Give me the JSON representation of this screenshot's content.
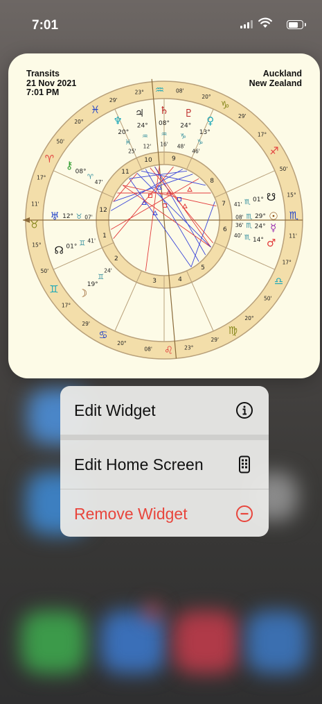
{
  "status_bar": {
    "time": "7:01"
  },
  "widget": {
    "header_left": [
      "Transits",
      "21 Nov 2021",
      "7:01 PM"
    ],
    "header_right": [
      "Auckland",
      "New Zealand"
    ],
    "colors": {
      "wheel_band": "#f3deaa",
      "wheel_line": "#b8a07a",
      "bg": "#fdfbe7",
      "aspect_red": "#e23b3b",
      "aspect_blue": "#3a45d8"
    },
    "house_numbers": [
      "1",
      "2",
      "3",
      "4",
      "5",
      "6",
      "7",
      "8",
      "9",
      "10",
      "11",
      "12"
    ],
    "sign_cusps": [
      {
        "glyph": "♒",
        "deg": "23°",
        "min": "08'",
        "color": "#1aa7b8"
      },
      {
        "glyph": "♑",
        "deg": "20°",
        "min": "29'",
        "color": "#8a8a20"
      },
      {
        "glyph": "♐",
        "deg": "17°",
        "min": "50'",
        "color": "#e23b3b"
      },
      {
        "glyph": "♏",
        "deg": "15°",
        "min": "11'",
        "color": "#2344c8"
      },
      {
        "glyph": "♎",
        "deg": "17°",
        "min": "50'",
        "color": "#1aa7b8"
      },
      {
        "glyph": "♍",
        "deg": "20°",
        "min": "29'",
        "color": "#8a8a20"
      },
      {
        "glyph": "♌",
        "deg": "23°",
        "min": "08'",
        "color": "#e23b3b"
      },
      {
        "glyph": "♋",
        "deg": "20°",
        "min": "29'",
        "color": "#2344c8"
      },
      {
        "glyph": "♊",
        "deg": "17°",
        "min": "50'",
        "color": "#1aa7b8"
      },
      {
        "glyph": "♉",
        "deg": "15°",
        "min": "11'",
        "color": "#8a8a20"
      },
      {
        "glyph": "♈",
        "deg": "17°",
        "min": "50'",
        "color": "#e23b3b"
      },
      {
        "glyph": "♓",
        "deg": "20°",
        "min": "29'",
        "color": "#2344c8"
      }
    ],
    "planets": [
      {
        "glyph": "♃",
        "deg": "24°",
        "sign": "♒",
        "min": "12'",
        "color": "#333"
      },
      {
        "glyph": "♄",
        "deg": "08°",
        "sign": "♒",
        "min": "16'",
        "color": "#b22"
      },
      {
        "glyph": "♇",
        "deg": "24°",
        "sign": "♑",
        "min": "48'",
        "color": "#b22"
      },
      {
        "glyph": "♀",
        "deg": "13°",
        "sign": "♑",
        "min": "46'",
        "color": "#1aa7b8"
      },
      {
        "glyph": "♆",
        "deg": "20°",
        "sign": "♓",
        "min": "25'",
        "color": "#1aa7b8"
      },
      {
        "glyph": "⚷",
        "deg": "08°",
        "sign": "♈",
        "min": "47'",
        "color": "#2a9a2a"
      },
      {
        "glyph": "♅",
        "deg": "12°",
        "sign": "♉",
        "min": "07'",
        "color": "#2344c8"
      },
      {
        "glyph": "☊",
        "deg": "01°",
        "sign": "♊",
        "min": "41'",
        "color": "#111"
      },
      {
        "glyph": "☽",
        "deg": "19°",
        "sign": "♊",
        "min": "24'",
        "color": "#8a4a10"
      },
      {
        "glyph": "☋",
        "deg": "01°",
        "sign": "♏",
        "min": "41'",
        "color": "#111"
      },
      {
        "glyph": "☉",
        "deg": "29°",
        "sign": "♏",
        "min": "08'",
        "color": "#8a4a10"
      },
      {
        "glyph": "☿",
        "deg": "24°",
        "sign": "♏",
        "min": "36'",
        "color": "#9a30b0"
      },
      {
        "glyph": "♂",
        "deg": "14°",
        "sign": "♏",
        "min": "40'",
        "color": "#e23b3b"
      }
    ]
  },
  "context_menu": {
    "items": [
      {
        "label": "Edit Widget",
        "icon": "info-icon",
        "destructive": false
      },
      {
        "label": "Edit Home Screen",
        "icon": "phone-apps-icon",
        "destructive": false
      },
      {
        "label": "Remove Widget",
        "icon": "minus-circle-icon",
        "destructive": true
      }
    ],
    "colors": {
      "destructive": "#e8453c",
      "text": "#111"
    }
  }
}
